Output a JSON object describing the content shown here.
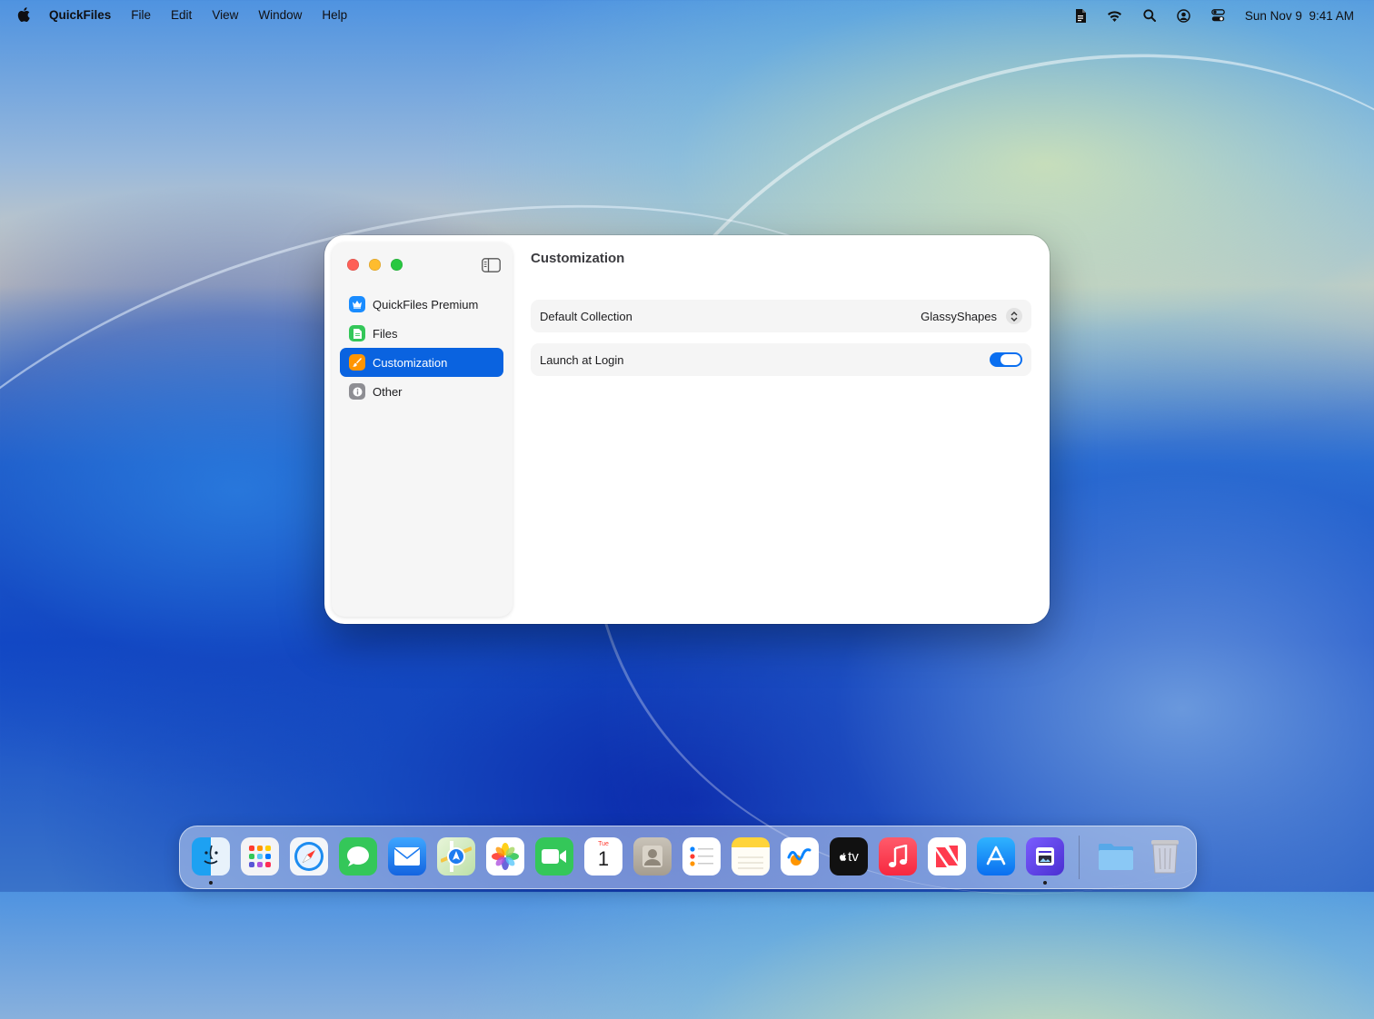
{
  "menubar": {
    "app_name": "QuickFiles",
    "menus": [
      "File",
      "Edit",
      "View",
      "Window",
      "Help"
    ],
    "clock_date": "Sun Nov 9",
    "clock_time": "9:41 AM",
    "status_icons": [
      "document-icon",
      "wifi-icon",
      "spotlight-search-icon",
      "user-account-icon",
      "control-center-icon"
    ]
  },
  "window": {
    "sidebar": {
      "items": [
        {
          "label": "QuickFiles Premium",
          "icon": "crown-icon",
          "color": "#1a8cff",
          "active": false
        },
        {
          "label": "Files",
          "icon": "document-icon",
          "color": "#34c759",
          "active": false
        },
        {
          "label": "Customization",
          "icon": "paintbrush-icon",
          "color": "#ff9500",
          "active": true
        },
        {
          "label": "Other",
          "icon": "info-icon",
          "color": "#8e8e93",
          "active": false
        }
      ]
    },
    "content": {
      "title": "Customization",
      "default_collection": {
        "label": "Default Collection",
        "value": "GlassyShapes"
      },
      "launch_at_login": {
        "label": "Launch at Login",
        "value": "on"
      }
    }
  },
  "dock": {
    "apps": [
      {
        "name": "Finder",
        "icon": "finder-icon",
        "running": true
      },
      {
        "name": "Launchpad",
        "icon": "launchpad-icon",
        "running": false
      },
      {
        "name": "Safari",
        "icon": "safari-icon",
        "running": false
      },
      {
        "name": "Messages",
        "icon": "messages-icon",
        "running": false
      },
      {
        "name": "Mail",
        "icon": "mail-icon",
        "running": false
      },
      {
        "name": "Maps",
        "icon": "maps-icon",
        "running": false
      },
      {
        "name": "Photos",
        "icon": "photos-icon",
        "running": false
      },
      {
        "name": "FaceTime",
        "icon": "facetime-icon",
        "running": false
      },
      {
        "name": "Calendar",
        "icon": "calendar-icon",
        "running": false,
        "weekday": "Tue",
        "day": "1"
      },
      {
        "name": "Contacts",
        "icon": "contacts-icon",
        "running": false
      },
      {
        "name": "Reminders",
        "icon": "reminders-icon",
        "running": false
      },
      {
        "name": "Notes",
        "icon": "notes-icon",
        "running": false
      },
      {
        "name": "Freeform",
        "icon": "freeform-icon",
        "running": false
      },
      {
        "name": "TV",
        "icon": "appletv-icon",
        "running": false,
        "label": "tv"
      },
      {
        "name": "Music",
        "icon": "music-icon",
        "running": false
      },
      {
        "name": "News",
        "icon": "news-icon",
        "running": false
      },
      {
        "name": "App Store",
        "icon": "appstore-icon",
        "running": false
      },
      {
        "name": "QuickFiles",
        "icon": "quickfiles-icon",
        "running": true
      }
    ],
    "extras": [
      {
        "name": "Downloads",
        "icon": "folder-icon"
      },
      {
        "name": "Trash",
        "icon": "trash-icon"
      }
    ]
  }
}
